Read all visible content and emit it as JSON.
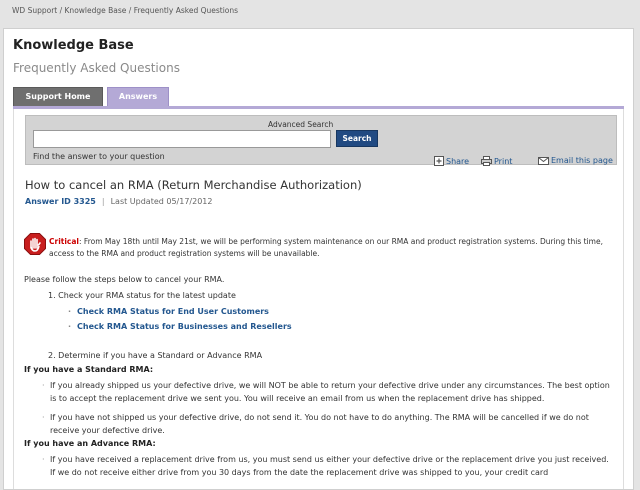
{
  "breadcrumb": "WD Support / Knowledge Base / Frequently Asked Questions",
  "header": {
    "title": "Knowledge Base",
    "subtitle": "Frequently Asked Questions"
  },
  "tabs": [
    {
      "label": "Support Home"
    },
    {
      "label": "Answers"
    }
  ],
  "search": {
    "advanced_label": "Advanced Search",
    "input_value": "",
    "button_label": "Search",
    "helper_text": "Find the answer to your question"
  },
  "article": {
    "title": "How to cancel an RMA (Return Merchandise Authorization)",
    "answer_id": "Answer ID 3325",
    "separator": "|",
    "last_updated": "Last Updated 05/17/2012"
  },
  "tools": {
    "share": "Share",
    "print": "Print",
    "email": "Email this page"
  },
  "alert": {
    "label": "Critical",
    "text": ": From May 18th until May 21st, we will be performing system maintenance on our RMA and product registration systems. During this time, access to the RMA and product registration systems will be unavailable."
  },
  "content": {
    "intro": "Please follow the steps below to cancel your RMA.",
    "step1": "1.  Check your RMA status for the latest update",
    "links": [
      "Check RMA Status for End User Customers",
      "Check RMA Status for Businesses and Resellers"
    ],
    "step2": "2.  Determine if you have a Standard or Advance RMA",
    "standard_heading": "If you have a Standard RMA",
    "standard_items": [
      "If you already shipped us your defective drive, we will NOT be able to return your defective drive under any circumstances. The best option is to accept the replacement drive we sent you. You will receive an email from us when the replacement drive has shipped.",
      "If you have not shipped us your defective drive, do not send it. You do not have to do anything. The RMA will be cancelled if we do not receive your defective drive."
    ],
    "advance_heading": "If you have an Advance RMA",
    "advance_items": [
      "If you have received a replacement drive from us, you must send us either your defective drive or the replacement drive you just received. If we do not receive either drive from you 30 days from the date the replacement drive was shipped to you, your credit card"
    ],
    "colon": ":"
  },
  "colors": {
    "link": "#23578f",
    "critical": "#cc0000",
    "tab_active": "#b4a9d6",
    "tab_inactive": "#6f6f6f",
    "search_button": "#214a82"
  }
}
